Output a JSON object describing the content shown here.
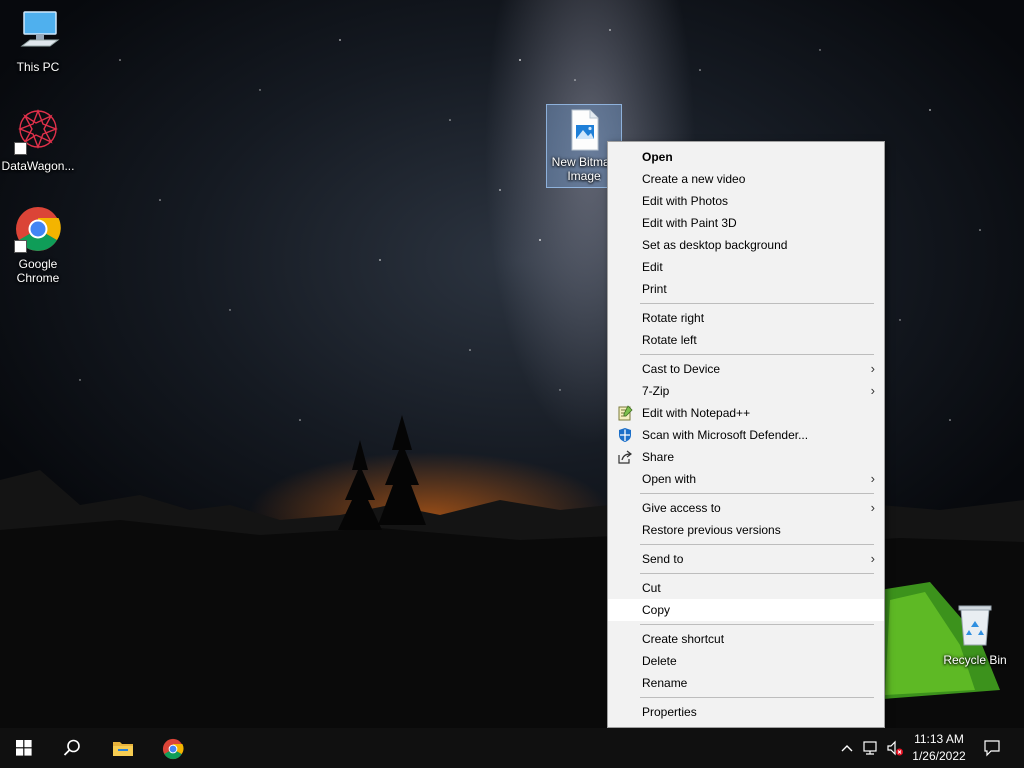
{
  "desktop": {
    "icons": [
      {
        "label": "This PC",
        "icon": "computer-icon"
      },
      {
        "label": "DataWagon...",
        "icon": "datawagon-icon"
      },
      {
        "label": "Google\nChrome",
        "icon": "chrome-icon"
      },
      {
        "label": "New Bitmap\nImage",
        "icon": "image-file-icon"
      },
      {
        "label": "Recycle Bin",
        "icon": "recycle-bin-icon"
      }
    ]
  },
  "context_menu": {
    "items": [
      {
        "label": "Open",
        "bold": true
      },
      {
        "label": "Create a new video"
      },
      {
        "label": "Edit with Photos"
      },
      {
        "label": "Edit with Paint 3D"
      },
      {
        "label": "Set as desktop background"
      },
      {
        "label": "Edit"
      },
      {
        "label": "Print"
      },
      {
        "label": "Rotate right"
      },
      {
        "label": "Rotate left"
      },
      {
        "label": "Cast to Device",
        "submenu": true
      },
      {
        "label": "7-Zip",
        "submenu": true
      },
      {
        "label": "Edit with Notepad++",
        "icon": "notepad-plus-plus-icon"
      },
      {
        "label": "Scan with Microsoft Defender...",
        "icon": "defender-shield-icon"
      },
      {
        "label": "Share",
        "icon": "share-icon"
      },
      {
        "label": "Open with",
        "submenu": true
      },
      {
        "label": "Give access to",
        "submenu": true
      },
      {
        "label": "Restore previous versions"
      },
      {
        "label": "Send to",
        "submenu": true
      },
      {
        "label": "Cut"
      },
      {
        "label": "Copy",
        "highlighted": true
      },
      {
        "label": "Create shortcut"
      },
      {
        "label": "Delete"
      },
      {
        "label": "Rename"
      },
      {
        "label": "Properties"
      }
    ],
    "submenu_arrow": "›"
  },
  "taskbar": {
    "pinned": [
      "start-icon",
      "search-icon",
      "file-explorer-icon",
      "chrome-icon"
    ],
    "tray": {
      "icons": [
        "chevron-up-icon",
        "network-icon",
        "volume-muted-icon"
      ],
      "time": "11:13 AM",
      "date": "1/26/2022",
      "notification_icon": "action-center-icon"
    }
  },
  "colors": {
    "menu_background": "#f2f2f2",
    "menu_highlight": "#ffffff",
    "taskbar": "#101010",
    "selection": "#78aae6"
  }
}
